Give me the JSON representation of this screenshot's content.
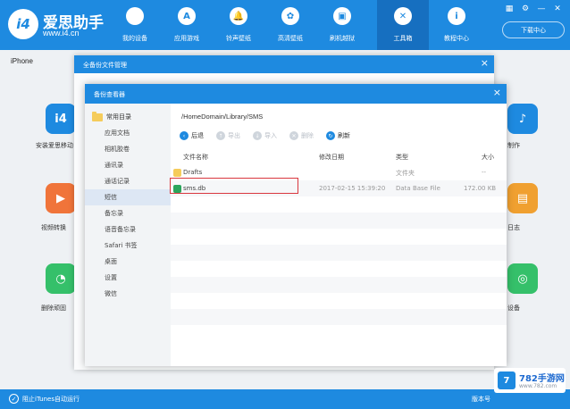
{
  "app": {
    "brand_name": "爱思助手",
    "brand_url": "www.i4.cn",
    "logo_text": "i4"
  },
  "nav": [
    {
      "label": "我的设备",
      "icon": "apple-icon",
      "glyph": ""
    },
    {
      "label": "应用游戏",
      "icon": "app-store-icon",
      "glyph": "A"
    },
    {
      "label": "铃声壁纸",
      "icon": "bell-icon",
      "glyph": "🔔"
    },
    {
      "label": "高清壁纸",
      "icon": "wallpaper-icon",
      "glyph": "✿"
    },
    {
      "label": "刷机越狱",
      "icon": "box-icon",
      "glyph": "▣"
    },
    {
      "label": "工具箱",
      "icon": "tools-icon",
      "glyph": "✕"
    },
    {
      "label": "教程中心",
      "icon": "info-icon",
      "glyph": "i"
    }
  ],
  "window_controls": [
    "▦",
    "⚙",
    "—",
    "✕"
  ],
  "download_button": "下载中心",
  "device_label": "iPhone",
  "bg_tiles": {
    "left": [
      {
        "label": "安装爱思移动",
        "glyph": "i4",
        "color": "#1e8ae0"
      },
      {
        "label": "视频转换",
        "glyph": "▶",
        "color": "#f0743a"
      },
      {
        "label": "删除顽固",
        "glyph": "◔",
        "color": "#35c06a"
      }
    ],
    "right": [
      {
        "label": "制作",
        "glyph": "♪",
        "color": "#1e8ae0"
      },
      {
        "label": "日志",
        "glyph": "▤",
        "color": "#f0a030"
      },
      {
        "label": "设备",
        "glyph": "◎",
        "color": "#35c06a"
      }
    ]
  },
  "dialog_outer": {
    "title": "全备份文件管理",
    "close": "×"
  },
  "dialog": {
    "title": "备份查看器",
    "close": "×",
    "sidebar": {
      "category": "常用目录",
      "items": [
        "应用文档",
        "相机胶卷",
        "通讯录",
        "通话记录",
        "短信",
        "备忘录",
        "语音备忘录",
        "Safari 书签",
        "桌面",
        "设置",
        "微信"
      ],
      "selected_index": 4
    },
    "path": "/HomeDomain/Library/SMS",
    "toolbar": [
      {
        "label": "后退",
        "glyph": "‹",
        "enabled": true
      },
      {
        "label": "导出",
        "glyph": "↑",
        "enabled": false
      },
      {
        "label": "导入",
        "glyph": "↓",
        "enabled": false
      },
      {
        "label": "删除",
        "glyph": "✕",
        "enabled": false
      },
      {
        "label": "刷新",
        "glyph": "↻",
        "enabled": true
      }
    ],
    "columns": {
      "name": "文件名称",
      "date": "修改日期",
      "type": "类型",
      "size": "大小"
    },
    "files": [
      {
        "name": "Drafts",
        "date": "",
        "type": "文件夹",
        "size": "--",
        "kind": "folder"
      },
      {
        "name": "sms.db",
        "date": "2017-02-15 15:39:20",
        "type": "Data Base File",
        "size": "172.00 KB",
        "kind": "db"
      }
    ]
  },
  "status": {
    "text": "阻止iTunes自动运行",
    "right": "版本号"
  },
  "watermark": {
    "box": "7",
    "name": "782手游网",
    "url": "www.782.com"
  }
}
